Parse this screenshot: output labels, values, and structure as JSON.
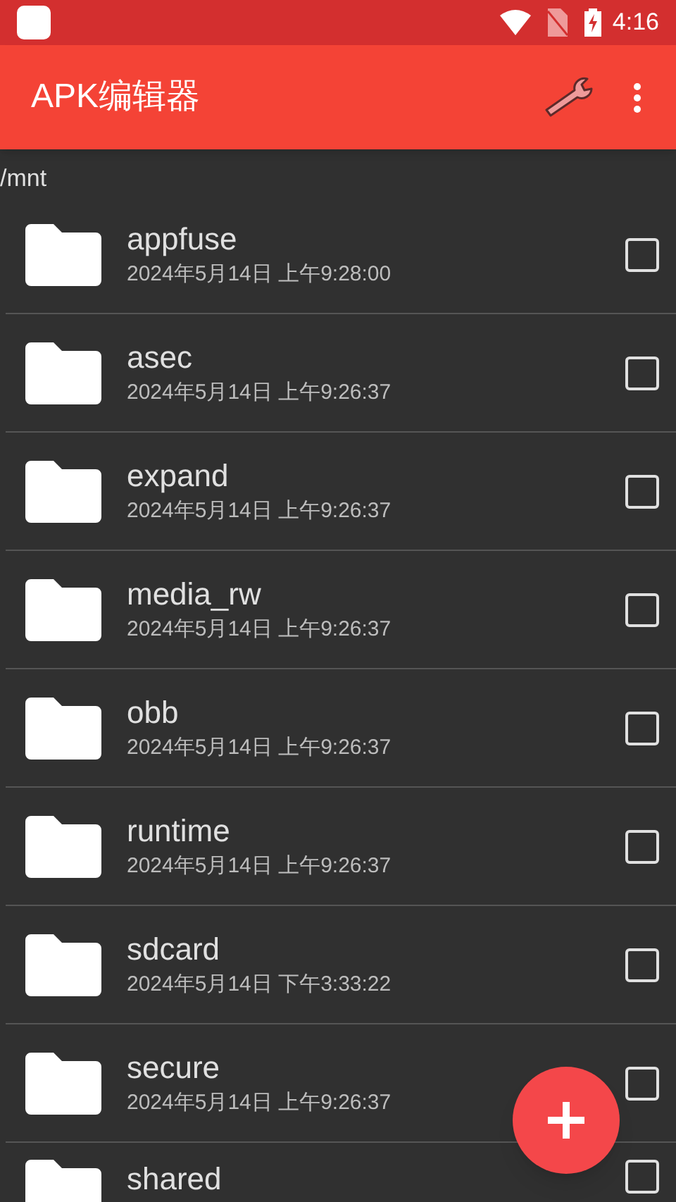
{
  "status_bar": {
    "time": "4:16"
  },
  "toolbar": {
    "title": "APK编辑器"
  },
  "path": "/mnt",
  "files": [
    {
      "name": "appfuse",
      "date": "2024年5月14日 上午9:28:00",
      "checked": false
    },
    {
      "name": "asec",
      "date": "2024年5月14日 上午9:26:37",
      "checked": false
    },
    {
      "name": "expand",
      "date": "2024年5月14日 上午9:26:37",
      "checked": false
    },
    {
      "name": "media_rw",
      "date": "2024年5月14日 上午9:26:37",
      "checked": false
    },
    {
      "name": "obb",
      "date": "2024年5月14日 上午9:26:37",
      "checked": false
    },
    {
      "name": "runtime",
      "date": "2024年5月14日 上午9:26:37",
      "checked": false
    },
    {
      "name": "sdcard",
      "date": "2024年5月14日 下午3:33:22",
      "checked": false
    },
    {
      "name": "secure",
      "date": "2024年5月14日 上午9:26:37",
      "checked": false
    },
    {
      "name": "shared",
      "checked": false
    }
  ]
}
